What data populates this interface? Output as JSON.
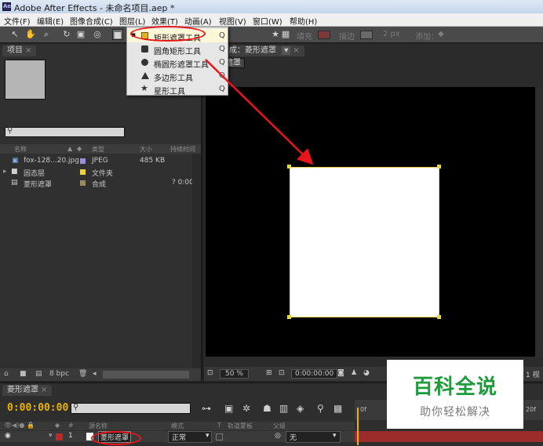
{
  "window": {
    "app_icon": "Ae",
    "title": "Adobe After Effects - 未命名项目.aep *"
  },
  "menu": [
    "文件(F)",
    "编辑(E)",
    "图像合成(C)",
    "图层(L)",
    "效果(T)",
    "动画(A)",
    "视图(V)",
    "窗口(W)",
    "帮助(H)"
  ],
  "toolbar": {
    "fill_label": "填充",
    "stroke_label": "描边",
    "stroke_width": "2 px",
    "add_label": "添加：",
    "fill_color": "#c03030",
    "stroke_color": "#9a9a9a"
  },
  "shape_menu": {
    "items": [
      {
        "label": "矩形遮罩工具",
        "shortcut": "Q",
        "icon": "rectangle-icon",
        "selected": true
      },
      {
        "label": "圆角矩形工具",
        "shortcut": "Q",
        "icon": "rounded-rectangle-icon",
        "selected": false
      },
      {
        "label": "椭圆形遮罩工具",
        "shortcut": "Q",
        "icon": "ellipse-icon",
        "selected": false
      },
      {
        "label": "多边形工具",
        "shortcut": "Q",
        "icon": "polygon-icon",
        "selected": false
      },
      {
        "label": "星形工具",
        "shortcut": "Q",
        "icon": "star-icon",
        "selected": false
      }
    ]
  },
  "project_panel": {
    "tab": "项目",
    "columns": {
      "name": "名称",
      "type": "类型",
      "size": "大小",
      "duration": "持续时间"
    },
    "items": [
      {
        "name": "fox-128...20.jpg",
        "label_color": "#9c8fd8",
        "type": "JPEG",
        "size": "485 KB",
        "duration": ""
      },
      {
        "name": "固态层",
        "label_color": "#e9d24a",
        "type": "文件夹",
        "size": "",
        "duration": ""
      },
      {
        "name": "菱形遮罩",
        "label_color": "#9a8a64",
        "type": "合成",
        "size": "",
        "duration": "? 0:00"
      }
    ],
    "bpc": "8 bpc"
  },
  "composition_panel": {
    "tab": "合成：菱形遮罩",
    "breadcrumb": "菱形遮罩",
    "zoom": "50 %",
    "timecode": "0:00:00:00",
    "right_label": "1 视"
  },
  "timeline_panel": {
    "tab": "菱形遮罩",
    "timecode": "0:00:00:00",
    "columns": {
      "num": "#",
      "source": "源名称",
      "mode": "模式",
      "t": "T",
      "trkmat": "轨道蒙板",
      "parent": "父级"
    },
    "layer": {
      "num": "1",
      "name": "菱形遮罩",
      "mode": "正常",
      "parent": "无"
    },
    "ruler_labels": [
      "0f",
      "20f"
    ]
  },
  "watermark": {
    "title": "百科全说",
    "subtitle": "助你轻松解决"
  }
}
